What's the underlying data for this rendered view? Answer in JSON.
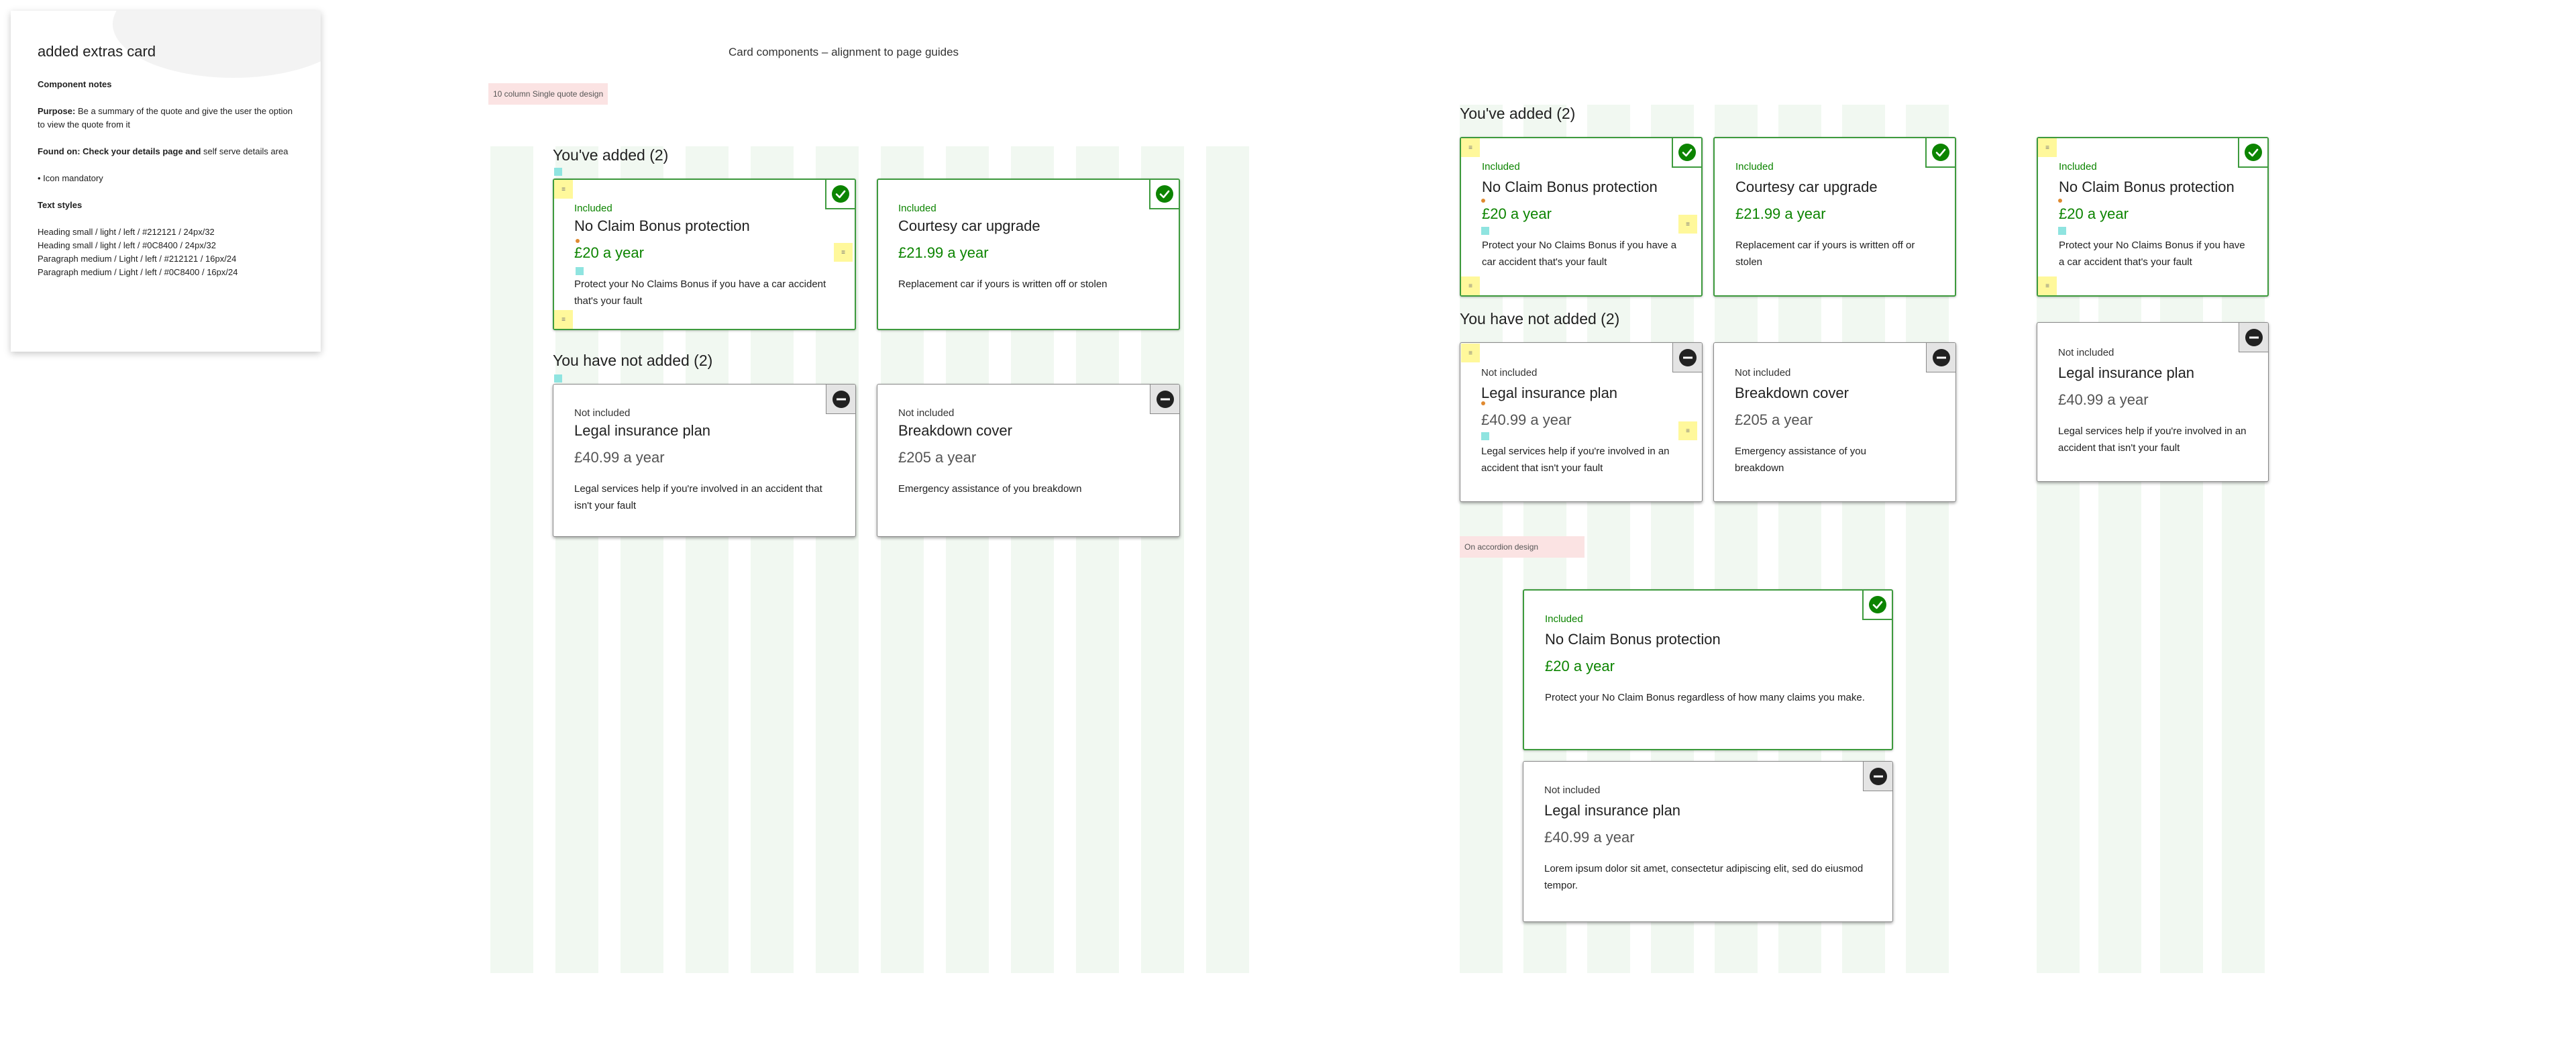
{
  "notes": {
    "title": "added extras card",
    "component_notes": "Component notes",
    "purpose_label": "Purpose:",
    "purpose_text": " Be a summary of the quote and give the user the option to view the quote from it",
    "found_label": "Found on: Check your details page and",
    "found_text": " self serve details area",
    "icon_note": "• Icon mandatory",
    "text_styles_label": "Text styles",
    "styles": [
      "Heading small / light / left / #212121 / 24px/32",
      "Heading small / light / left / #0C8400 / 24px/32",
      "Paragraph medium / Light / left / #212121 / 16px/24",
      "Paragraph medium / Light / left / #0C8400 / 16px/24"
    ]
  },
  "canvas_title": "Card components – alignment to page guides",
  "tags": {
    "single_quote": "10 column Single quote design",
    "accordion": "On accordion design"
  },
  "sections": {
    "added": "You've added (2)",
    "not_added": "You have not added (2)"
  },
  "status": {
    "included": "Included",
    "not_included": "Not included"
  },
  "products": {
    "ncb": {
      "title": "No Claim Bonus protection",
      "price": "£20 a year",
      "desc": "Protect your No Claims Bonus if you have a car accident that's your fault",
      "desc_accordion": "Protect your No Claim Bonus regardless of how many claims you make."
    },
    "courtesy": {
      "title": "Courtesy car upgrade",
      "price": "£21.99 a year",
      "desc_a": "Replacement car if yours is written off or stolen",
      "desc_b": "Replacement car if yours is written off or stolen"
    },
    "legal": {
      "title": "Legal insurance plan",
      "price": "£40.99 a year",
      "desc": "Legal services help if you're involved in an accident that isn't your fault",
      "desc_accordion": "Lorem ipsum dolor sit amet, consectetur adipiscing elit, sed do eiusmod tempor."
    },
    "breakdown": {
      "title": "Breakdown cover",
      "price": "£205 a year",
      "desc": "Emergency assistance of you breakdown"
    }
  },
  "colors": {
    "heading": "#212121",
    "accent_green": "#0C8400",
    "guide_column": "#f1f8f1",
    "tag_bg": "#fbe3e3",
    "sticky_note": "#fff89b"
  },
  "icons": {
    "included": "check-circle-icon",
    "not_included": "minus-circle-icon"
  }
}
